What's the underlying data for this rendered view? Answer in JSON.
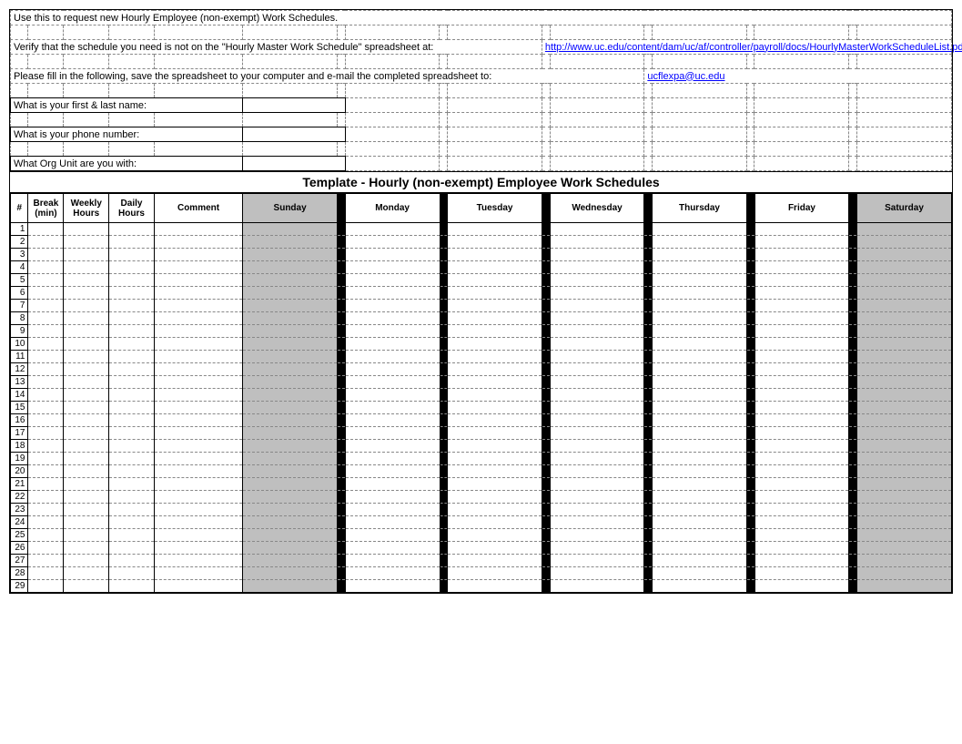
{
  "intro": {
    "line1": "Use this to request new Hourly Employee (non-exempt) Work Schedules.",
    "line2_pre": "Verify that the schedule you need is not on the \"Hourly Master Work Schedule\" spreadsheet at:",
    "line2_link": "http://www.uc.edu/content/dam/uc/af/controller/payroll/docs/HourlyMasterWorkScheduleList.pdf",
    "line3_pre": "Please fill in the following, save the spreadsheet to your computer and e-mail the completed spreadsheet to:",
    "line3_email": "ucflexpa@uc.edu"
  },
  "form": {
    "q_name": "What is your first & last name:",
    "q_phone": "What is your phone number:",
    "q_org": "What Org Unit are you with:",
    "a_name": "",
    "a_phone": "",
    "a_org": ""
  },
  "title": "Template - Hourly (non-exempt) Employee Work Schedules",
  "headers": {
    "num": "#",
    "break": "Break (min)",
    "weekly": "Weekly Hours",
    "daily": "Daily Hours",
    "comment": "Comment",
    "days": [
      "Sunday",
      "Monday",
      "Tuesday",
      "Wednesday",
      "Thursday",
      "Friday",
      "Saturday"
    ]
  },
  "rows": 29,
  "top_extra_cols": 13
}
